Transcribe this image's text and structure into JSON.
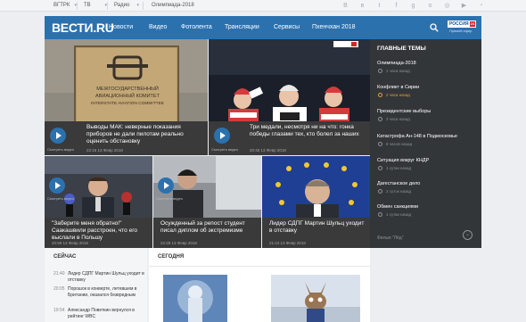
{
  "topbar": {
    "items": [
      "ВГТРК",
      "ТВ",
      "Радио",
      "Олимпиада-2018"
    ],
    "social_icons": [
      "blog-icon",
      "vk-icon",
      "twitter-icon",
      "facebook-icon",
      "google-plus-icon",
      "odnoklassniki-icon",
      "instagram-icon",
      "youtube-icon",
      "rss-icon"
    ]
  },
  "header": {
    "logo": "ВЕСТИ.RU",
    "nav": [
      "Новости",
      "Видео",
      "Фотолента",
      "Трансляции",
      "Сервисы",
      "Пхенчхан 2018"
    ],
    "russia24_logo": "РОССИЯ",
    "russia24_num": "24",
    "russia24_sub": "Прямой эфир"
  },
  "tiles": [
    {
      "title": "Выводы МАК: неверные показания приборов не дали пилотам реально оценить обстановку",
      "meta": "22:15   13 Февр 2018",
      "play_label": "Смотреть видео"
    },
    {
      "title": "Три медали, несмотря ни на что: гонка победы глазами тех, кто болел за наших",
      "meta": "20:45   13 Февр 2018",
      "play_label": "Смотреть видео"
    },
    {
      "title": "\"Заберите меня обратно!\" Саакашвили расстроен, что его выслали в Польшу",
      "meta": "20:59   13 Февр 2018",
      "play_label": "Смотреть видео"
    },
    {
      "title": "Осужденный за репост студент писал диплом об экстремизме",
      "meta": "22:28   13 Февр 2018",
      "play_label": "Смотреть видео"
    },
    {
      "title": "Лидер СДПГ Мартин Шульц уходит в отставку",
      "meta": "21:44   13 Февр 2018"
    }
  ],
  "sign_text": {
    "line1": "МЕЖГОСУДАРСТВЕННЫЙ",
    "line2": "АВИАЦИОННЫЙ КОМИТЕТ",
    "line3": "INTERSTATE AVIATION COMMITTEE",
    "emblem": "МАК"
  },
  "themes": {
    "heading": "ГЛАВНЫЕ ТЕМЫ",
    "items": [
      {
        "title": "Олимпиада-2018",
        "time": "1 часа назад"
      },
      {
        "title": "Конфликт в Сирии",
        "time": "2 часа назад"
      },
      {
        "title": "Президентские выборы",
        "time": "3 часа назад"
      },
      {
        "title": "Катастрофа Ан-148 в Подмосковье",
        "time": "8 часов назад"
      },
      {
        "title": "Ситуация вокруг КНДР",
        "time": "1 сутки назад"
      },
      {
        "title": "Дагестанское дело",
        "time": "2 суток назад"
      },
      {
        "title": "Обмен санкциями",
        "time": "1 сутки назад"
      }
    ],
    "bottom_item": "Фильм \"Лёд\""
  },
  "now": {
    "heading": "СЕЙЧАС",
    "items": [
      {
        "time": "21:40",
        "text": "Лидер СДПГ Мартин Шульц уходит в отставку"
      },
      {
        "time": "20:05",
        "text": "Порошок в конверте, летевшем в Британии, оказался безвредным"
      },
      {
        "time": "19:54",
        "text": "Александр Поветкин вернулся в рейтинг WBC"
      }
    ]
  },
  "today": {
    "heading": "СЕГОДНЯ"
  },
  "colors": {
    "brand_blue": "#2b71ae",
    "dark_panel": "#333639",
    "hot_accent": "#e2a03a"
  }
}
